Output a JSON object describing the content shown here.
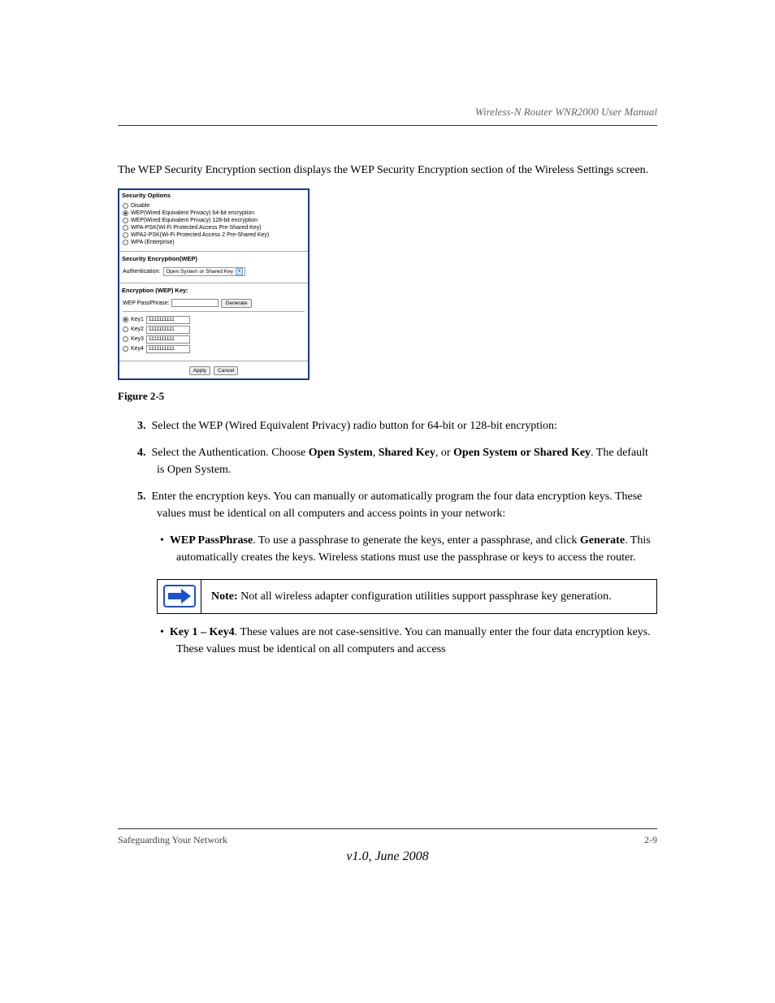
{
  "header": {
    "title": "Wireless-N Router WNR2000 User Manual"
  },
  "intro": "The WEP Security Encryption section displays the WEP Security Encryption section of the Wireless Settings screen.",
  "panel": {
    "sec_options_header": "Security Options",
    "options": [
      {
        "label": "Disable",
        "selected": false
      },
      {
        "label": "WEP(Wired Equivalent Privacy) 64-bit encryption",
        "selected": true
      },
      {
        "label": "WEP(Wired Equivalent Privacy) 128-bit encryption",
        "selected": false
      },
      {
        "label": "WPA-PSK(Wi-Fi Protected Access Pre-Shared Key)",
        "selected": false
      },
      {
        "label": "WPA2-PSK(Wi-Fi Protected Access 2 Pre-Shared Key)",
        "selected": false
      },
      {
        "label": "WPA (Enterprise)",
        "selected": false
      }
    ],
    "sec_enc_header": "Security Encryption(WEP)",
    "auth_label": "Authentication:",
    "auth_value": "Open System or Shared Key",
    "enc_key_header": "Encryption (WEP) Key:",
    "passphrase_label": "WEP PassPhrase:",
    "passphrase_value": "",
    "generate_btn": "Generate",
    "keys": [
      {
        "label": "Key1",
        "value": "1111111111",
        "selected": true
      },
      {
        "label": "Key2",
        "value": "1111111111",
        "selected": false
      },
      {
        "label": "Key3",
        "value": "1111111111",
        "selected": false
      },
      {
        "label": "Key4",
        "value": "1111111111",
        "selected": false
      }
    ],
    "apply_btn": "Apply",
    "cancel_btn": "Cancel"
  },
  "figure_caption": "Figure 2-5",
  "steps": {
    "s3": {
      "num": "3.",
      "text": "Select the WEP (Wired Equivalent Privacy) radio button for 64-bit or 128-bit encryption:"
    },
    "s4": {
      "num": "4.",
      "text": "Select the Authentication. Choose ",
      "bold1": "Open System",
      "mid": ", ",
      "bold2": "Shared Key",
      "mid2": ", or ",
      "bold3": "Open System or Shared Key",
      "tail": ". The default is Open System."
    },
    "s5": {
      "num": "5.",
      "text": "Enter the encryption keys. You can manually or automatically program the four data encryption keys. These values must be identical on all computers and access points in your network:"
    },
    "s5a": {
      "bullet": "•",
      "bold": "WEP PassPhrase",
      "text": ". To use a passphrase to generate the keys, enter a passphrase, and click ",
      "bold2": "Generate",
      "tail": ". This automatically creates the keys. Wireless stations must use the passphrase or keys to access the router."
    },
    "note": {
      "label": "Note:",
      "text": " Not all wireless adapter configuration utilities support passphrase key generation."
    },
    "s5b": {
      "bullet": "•",
      "bold": "Key 1 – Key4",
      "text": ". These values are not case-sensitive. You can manually enter the four data encryption keys. These values must be identical on all computers and access"
    }
  },
  "footer": {
    "left": "Safeguarding Your Network",
    "right": "2-9",
    "version": "v1.0, June 2008"
  }
}
